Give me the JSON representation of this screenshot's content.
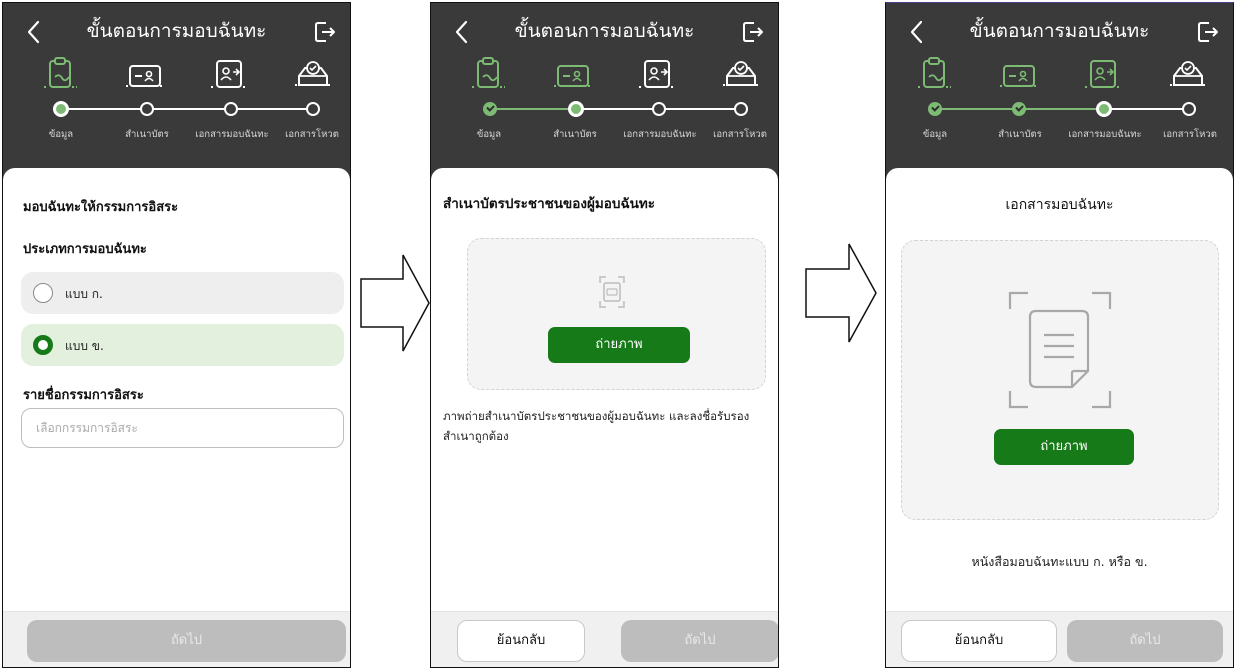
{
  "header": {
    "title": "ขั้นตอนการมอบฉันทะ",
    "back_icon": "chevron-left-icon",
    "exit_icon": "logout-icon"
  },
  "steps": [
    {
      "label": "ข้อมูล",
      "icon": "clipboard-icon"
    },
    {
      "label": "สำเนาบัตร",
      "icon": "id-card-icon"
    },
    {
      "label": "เอกสารมอบฉันทะ",
      "icon": "proxy-document-icon"
    },
    {
      "label": "เอกสารโหวต",
      "icon": "ballot-box-icon"
    }
  ],
  "screens": [
    {
      "active_step": 1,
      "section_title": "มอบฉันทะให้กรรมการอิสระ",
      "type_heading": "ประเภทการมอบฉันทะ",
      "options": [
        {
          "label": "แบบ ก.",
          "selected": false
        },
        {
          "label": "แบบ ข.",
          "selected": true
        }
      ],
      "directors_heading": "รายชื่อกรรมการอิสระ",
      "directors_placeholder": "เลือกกรรมการอิสระ",
      "next_label": "ถัดไป"
    },
    {
      "active_step": 2,
      "section_title": "สำเนาบัตรประชาชนของผู้มอบฉันทะ",
      "capture_label": "ถ่ายภาพ",
      "description": "ภาพถ่ายสำเนาบัตรประชาชนของผู้มอบฉันทะ และลงชื่อรับรองสำเนาถูกต้อง",
      "back_label": "ย้อนกลับ",
      "next_label": "ถัดไป"
    },
    {
      "active_step": 3,
      "section_title": "เอกสารมอบฉันทะ",
      "capture_label": "ถ่ายภาพ",
      "caption": "หนังสือมอบฉันทะแบบ ก. หรือ ข.",
      "back_label": "ย้อนกลับ",
      "next_label": "ถัดไป"
    }
  ],
  "colors": {
    "header_bg": "#3a3a3a",
    "accent_green": "#177a18",
    "progress_green": "#7dbb74",
    "selected_option_bg": "#e3f0dd",
    "disabled_button": "#bdbdbd"
  }
}
